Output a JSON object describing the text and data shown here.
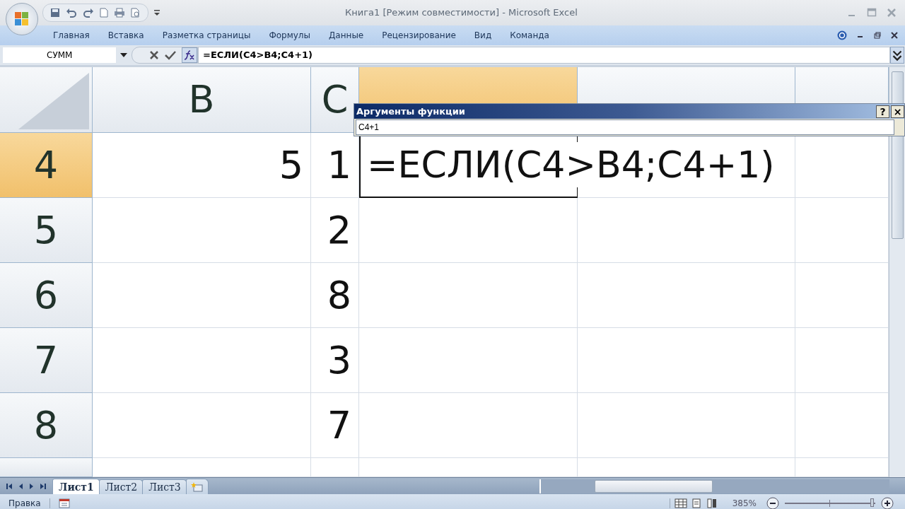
{
  "window": {
    "title": "Книга1  [Режим совместимости] - Microsoft Excel"
  },
  "ribbon_tabs": [
    {
      "label": "Главная"
    },
    {
      "label": "Вставка"
    },
    {
      "label": "Разметка страницы"
    },
    {
      "label": "Формулы"
    },
    {
      "label": "Данные"
    },
    {
      "label": "Рецензирование"
    },
    {
      "label": "Вид"
    },
    {
      "label": "Команда"
    }
  ],
  "formula_bar": {
    "name_box": "СУММ",
    "formula": "=ЕСЛИ(C4>B4;C4+1)"
  },
  "columns": [
    {
      "label": "B",
      "selected": false
    },
    {
      "label": "C",
      "selected": false
    },
    {
      "selected": true
    },
    {
      "selected": false
    }
  ],
  "rows": [
    {
      "label": "4",
      "selected": true,
      "editing": true,
      "b": "5",
      "c": "1",
      "d": "=ЕСЛИ(C4>B4;C4+1)"
    },
    {
      "label": "5",
      "selected": false,
      "editing": false,
      "c": "2"
    },
    {
      "label": "6",
      "selected": false,
      "editing": false,
      "c": "8"
    },
    {
      "label": "7",
      "selected": false,
      "editing": false,
      "c": "3"
    },
    {
      "label": "8",
      "selected": false,
      "editing": false,
      "c": "7"
    }
  ],
  "dialog": {
    "title": "Аргументы функции",
    "value": "C4+1",
    "help": "?",
    "close": "×"
  },
  "sheet_tabs": [
    {
      "label": "Лист1",
      "selected": true
    },
    {
      "label": "Лист2",
      "selected": false
    },
    {
      "label": "Лист3",
      "selected": false
    }
  ],
  "status_bar": {
    "mode": "Правка",
    "zoom": "385%",
    "zoom_slider": {
      "level": 0.97
    }
  }
}
